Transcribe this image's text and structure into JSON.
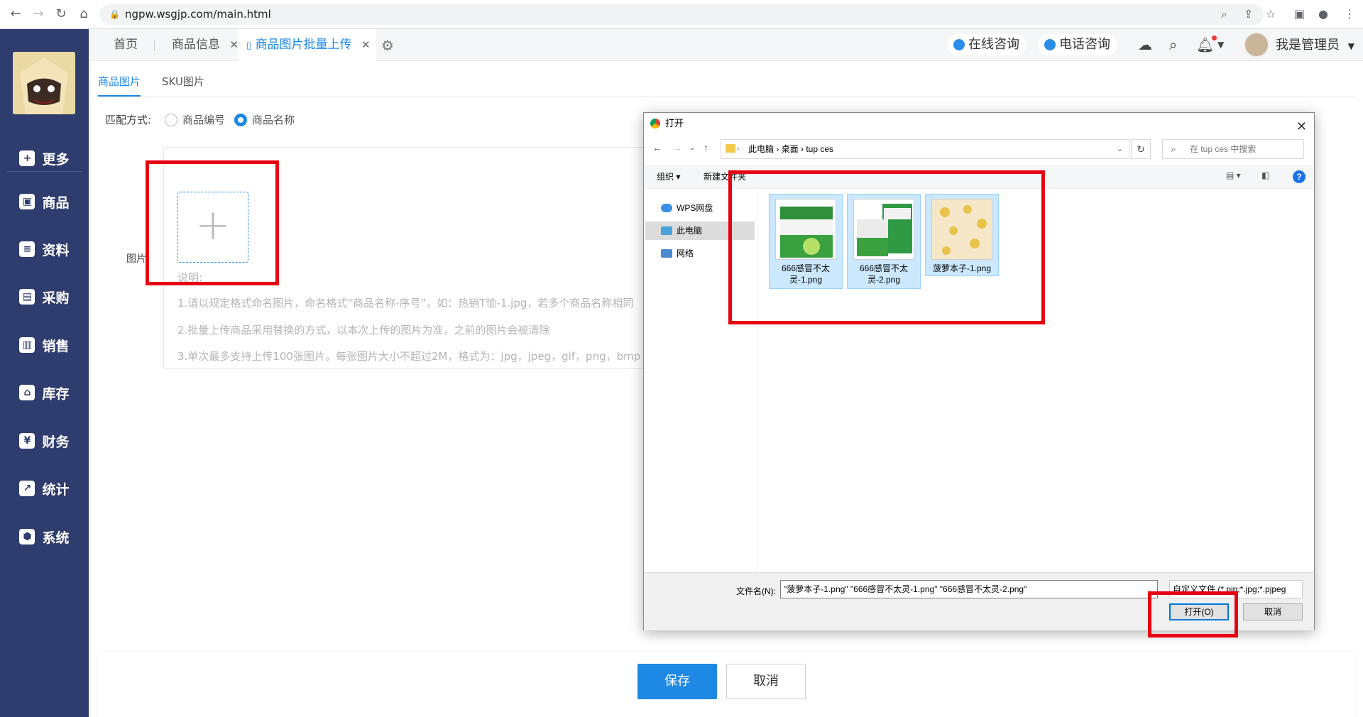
{
  "browser": {
    "url": "ngpw.wsgjp.com/main.html"
  },
  "sidebar": {
    "items": [
      {
        "label": "更多",
        "icon": "plus-square-icon"
      },
      {
        "label": "商品",
        "icon": "bag-icon"
      },
      {
        "label": "资料",
        "icon": "document-icon"
      },
      {
        "label": "采购",
        "icon": "purchase-icon"
      },
      {
        "label": "销售",
        "icon": "chart-bars-icon"
      },
      {
        "label": "库存",
        "icon": "warehouse-icon"
      },
      {
        "label": "财务",
        "icon": "yen-icon"
      },
      {
        "label": "统计",
        "icon": "line-chart-icon"
      },
      {
        "label": "系统",
        "icon": "hexagon-icon"
      }
    ]
  },
  "topbar": {
    "tabs": [
      {
        "label": "首页"
      },
      {
        "label": "商品信息",
        "close": "✕"
      },
      {
        "label": "商品图片批量上传",
        "close": "✕",
        "active": true
      }
    ],
    "online_consult": "在线咨询",
    "phone_consult": "电话咨询",
    "user_name": "我是管理员"
  },
  "main": {
    "subtabs": [
      "商品图片",
      "SKU图片"
    ],
    "match_label": "匹配方式:",
    "match_options": [
      "商品编号",
      "商品名称"
    ],
    "match_selected": "商品名称",
    "image_label": "图片:",
    "plus": "+",
    "note_title": "说明:",
    "notes": [
      "1.请以规定格式命名图片，命名格式“商品名称-序号”，如：热销T恤-1.jpg，若多个商品名称相同",
      "2.批量上传商品采用替换的方式，以本次上传的图片为准，之前的图片会被清除",
      "3.单次最多支持上传100张图片。每张图片大小不超过2M，格式为：jpg，jpeg，gif，png，bmp"
    ],
    "save": "保存",
    "cancel": "取消"
  },
  "dialog": {
    "title": "打开",
    "breadcrumb": "此电脑  ›  桌面  ›  tup ces",
    "search_placeholder": "在 tup ces 中搜索",
    "organize": "组织 ▾",
    "new_folder": "新建文件夹",
    "nav_items": [
      "WPS网盘",
      "此电脑",
      "网络"
    ],
    "files": [
      {
        "name": "666感冒不太灵-1.png"
      },
      {
        "name": "666感冒不太灵-2.png"
      },
      {
        "name": "菠萝本子-1.png"
      }
    ],
    "filename_label": "文件名(N):",
    "filename_value": "\"菠萝本子-1.png\" \"666感冒不太灵-1.png\" \"666感冒不太灵-2.png\"",
    "filetype": "自定义文件 (*.pjp;*.jpg;*.pjpeg",
    "open_button": "打开(O)",
    "cancel_button": "取消"
  },
  "colors": {
    "sidebar_bg": "#2f3d6e",
    "accent": "#1e88e5",
    "highlight_box": "#e60012"
  }
}
